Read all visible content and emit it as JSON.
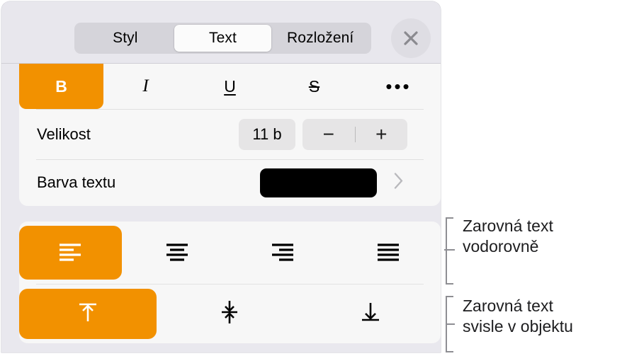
{
  "panel": {
    "header": {
      "segmented_control": {
        "options": [
          {
            "label": "Styl",
            "selected": false
          },
          {
            "label": "Text",
            "selected": true
          },
          {
            "label": "Rozložení",
            "selected": false
          }
        ]
      },
      "close_button": {
        "icon": "close-icon",
        "label": ""
      }
    },
    "text_card": {
      "style_row": {
        "buttons": [
          {
            "label": "B",
            "name": "bold",
            "selected": true
          },
          {
            "label": "I",
            "name": "italic",
            "selected": false
          },
          {
            "label": "U",
            "name": "underline",
            "selected": false
          },
          {
            "label": "S",
            "name": "strikethrough",
            "selected": false
          },
          {
            "label": "•••",
            "name": "more-options",
            "selected": false
          }
        ]
      },
      "size_row": {
        "label": "Velikost",
        "value": "11 b",
        "decrement_label": "−",
        "increment_label": "+"
      },
      "color_row": {
        "label": "Barva textu",
        "swatch_color": "#000000",
        "chevron": "chevron-right-icon"
      }
    },
    "alignment_card": {
      "horizontal": {
        "buttons": [
          {
            "name": "align-left",
            "selected": true
          },
          {
            "name": "align-center",
            "selected": false
          },
          {
            "name": "align-right",
            "selected": false
          },
          {
            "name": "align-justify",
            "selected": false
          }
        ]
      },
      "vertical": {
        "buttons": [
          {
            "name": "align-top",
            "selected": true
          },
          {
            "name": "align-middle",
            "selected": false
          },
          {
            "name": "align-bottom",
            "selected": false
          }
        ]
      }
    }
  },
  "annotations": [
    {
      "text": "Zarovná text\nvodorovně"
    },
    {
      "text": "Zarovná text\nsvisle v objektu"
    }
  ],
  "colors": {
    "accent": "#f29100",
    "panel_bg": "#e9e8ee",
    "card_bg": "#f7f7f7",
    "selected_seg_bg": "#fbfbfb",
    "text": "#000000"
  }
}
